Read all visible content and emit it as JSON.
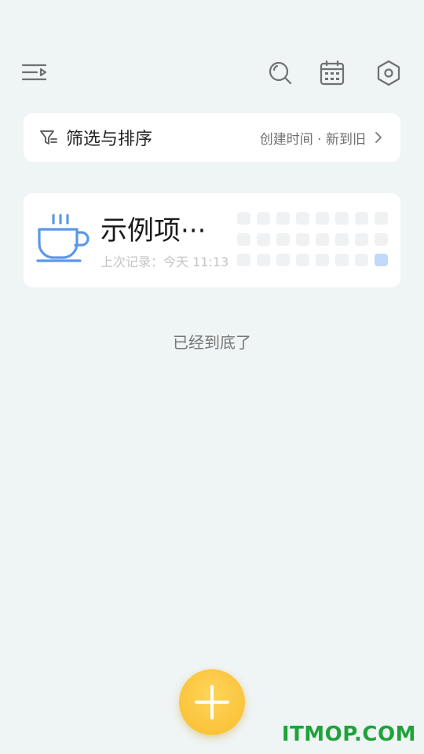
{
  "toolbar": {
    "menu_icon": "menu-collapse-icon",
    "search_icon": "search-icon",
    "calendar_icon": "calendar-icon",
    "settings_icon": "hexagon-settings-icon"
  },
  "filter_bar": {
    "label": "筛选与排序",
    "sort_value": "创建时间 · 新到旧",
    "icon": "filter-icon"
  },
  "items": [
    {
      "icon": "coffee-cup-icon",
      "title": "示例项···",
      "subtitle": "上次记录：今天 11:13",
      "grid": {
        "rows": 3,
        "cols": 8,
        "active_cells": [
          [
            2,
            7
          ]
        ]
      }
    }
  ],
  "list_end_text": "已经到底了",
  "fab": {
    "icon": "plus-icon"
  },
  "watermark": "ITMOP.COM",
  "colors": {
    "background": "#eff4f4",
    "accent_blue": "#5b97e8",
    "fab_yellow": "#f9bd2d",
    "active_cell": "#c3d9f9",
    "watermark_green": "#1ea33a"
  }
}
